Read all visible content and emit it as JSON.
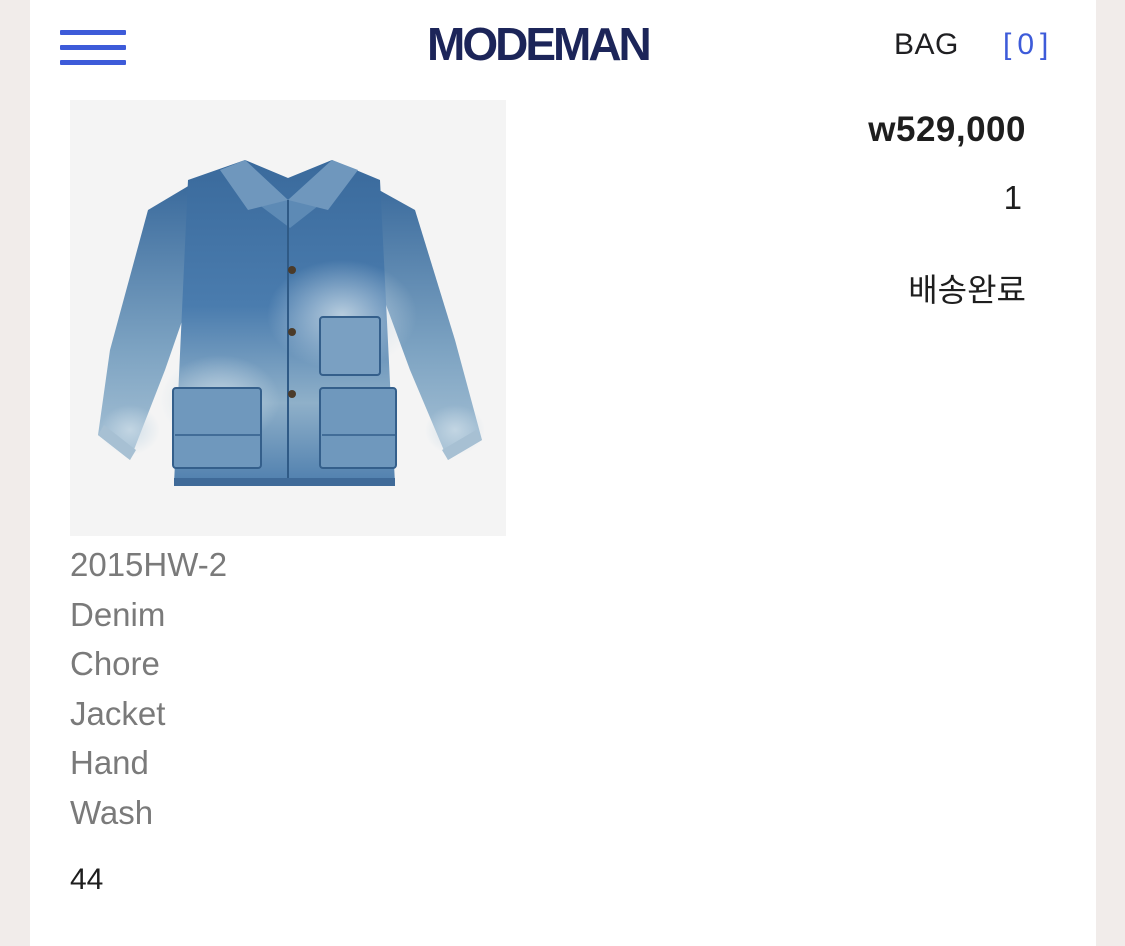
{
  "header": {
    "logo": "MODEMAN",
    "bag_label": "BAG",
    "bag_count": "[0]",
    "menu_icon": "hamburger-menu-icon"
  },
  "order_item": {
    "name": "2015HW-2 Denim Chore Jacket Hand Wash",
    "size": "44",
    "price": "w529,000",
    "quantity": "1",
    "status": "배송완료",
    "image_icon": "denim-jacket-image"
  },
  "colors": {
    "brand_navy": "#1c2559",
    "accent_blue": "#3d5bd9",
    "page_background": "#f1ecea",
    "card_background": "#ffffff",
    "image_background": "#f4f4f4",
    "muted_text": "#7a7a7a",
    "denim": "#3f6f9f"
  }
}
